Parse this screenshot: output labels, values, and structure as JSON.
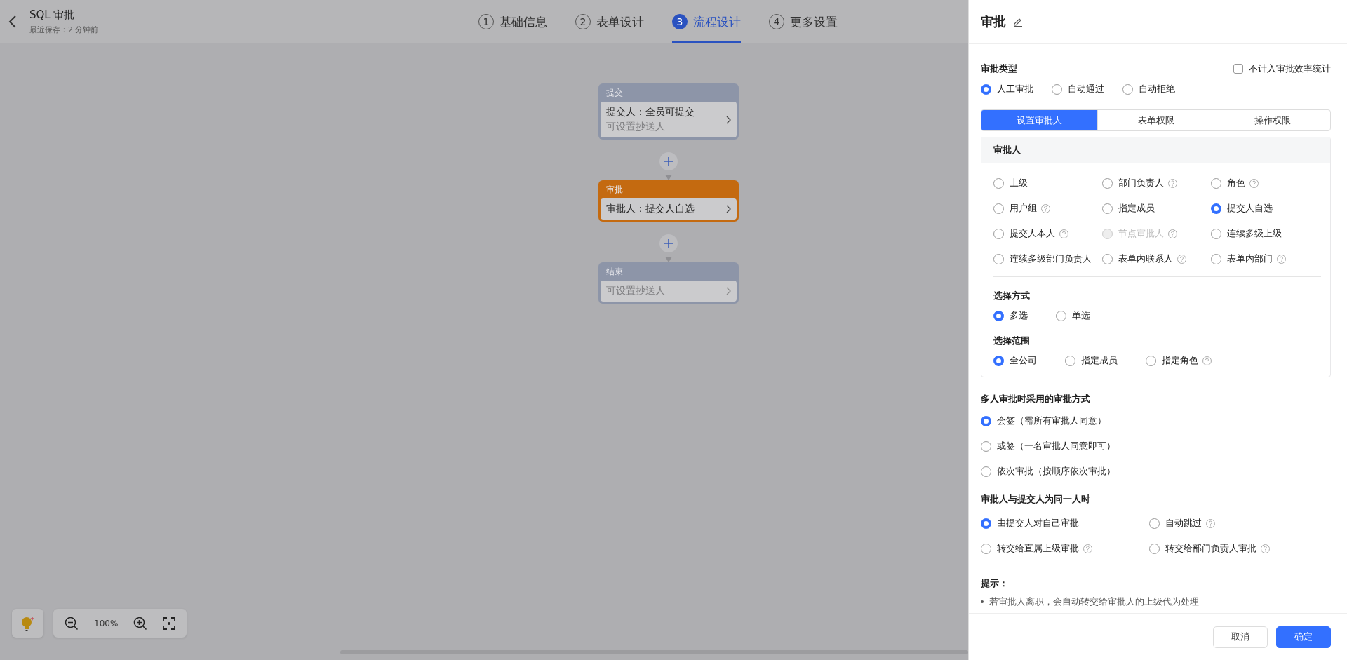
{
  "header": {
    "title": "SQL 审批",
    "subtitle": "最近保存：2 分钟前"
  },
  "steps": [
    {
      "number": "1",
      "label": "基础信息",
      "selected": false
    },
    {
      "number": "2",
      "label": "表单设计",
      "selected": false
    },
    {
      "number": "3",
      "label": "流程设计",
      "selected": true
    },
    {
      "number": "4",
      "label": "更多设置",
      "selected": false
    }
  ],
  "flow": {
    "nodes": [
      {
        "kind": "start",
        "title": "提交",
        "lines": [
          {
            "text": "提交人：全员可提交",
            "muted": false
          },
          {
            "text": "可设置抄送人",
            "muted": true
          }
        ]
      },
      {
        "kind": "approval",
        "title": "审批",
        "lines": [
          {
            "text": "审批人：提交人自选",
            "muted": false
          }
        ]
      },
      {
        "kind": "end",
        "title": "结束",
        "lines": [
          {
            "text": "可设置抄送人",
            "muted": true
          }
        ]
      }
    ]
  },
  "zoom_controls": {
    "zoom": "100%"
  },
  "panel": {
    "title": "审批",
    "type_label": "审批类型",
    "exclude_stats": {
      "label": "不计入审批效率统计",
      "checked": false
    },
    "approval_types": [
      {
        "label": "人工审批",
        "selected": true
      },
      {
        "label": "自动通过",
        "selected": false
      },
      {
        "label": "自动拒绝",
        "selected": false
      }
    ],
    "tabs": [
      {
        "label": "设置审批人",
        "selected": true
      },
      {
        "label": "表单权限",
        "selected": false
      },
      {
        "label": "操作权限",
        "selected": false
      }
    ],
    "approver": {
      "title": "审批人",
      "options": [
        {
          "label": "上级",
          "selected": false,
          "disabled": false,
          "kind": "plain"
        },
        {
          "label": "部门负责人",
          "selected": false,
          "disabled": false,
          "kind": "help"
        },
        {
          "label": "角色",
          "selected": false,
          "disabled": false,
          "kind": "help"
        },
        {
          "label": "用户组",
          "selected": false,
          "disabled": false,
          "kind": "help"
        },
        {
          "label": "指定成员",
          "selected": false,
          "disabled": false,
          "kind": "plain"
        },
        {
          "label": "提交人自选",
          "selected": true,
          "disabled": false,
          "kind": "plain"
        },
        {
          "label": "提交人本人",
          "selected": false,
          "disabled": false,
          "kind": "help"
        },
        {
          "label": "节点审批人",
          "selected": false,
          "disabled": true,
          "kind": "help"
        },
        {
          "label": "连续多级上级",
          "selected": false,
          "disabled": false,
          "kind": "plain"
        },
        {
          "label": "连续多级部门负责人",
          "selected": false,
          "disabled": false,
          "kind": "plain"
        },
        {
          "label": "表单内联系人",
          "selected": false,
          "disabled": false,
          "kind": "help"
        },
        {
          "label": "表单内部门",
          "selected": false,
          "disabled": false,
          "kind": "help"
        }
      ]
    },
    "select_mode": {
      "title": "选择方式",
      "options": [
        {
          "label": "多选",
          "selected": true
        },
        {
          "label": "单选",
          "selected": false
        }
      ]
    },
    "select_scope": {
      "title": "选择范围",
      "options": [
        {
          "label": "全公司",
          "selected": true,
          "kind": "plain"
        },
        {
          "label": "指定成员",
          "selected": false,
          "kind": "plain"
        },
        {
          "label": "指定角色",
          "selected": false,
          "kind": "help"
        }
      ]
    },
    "multi_approval": {
      "title": "多人审批时采用的审批方式",
      "options": [
        {
          "label": "会签（需所有审批人同意）",
          "selected": true
        },
        {
          "label": "或签（一名审批人同意即可）",
          "selected": false
        },
        {
          "label": "依次审批（按顺序依次审批）",
          "selected": false
        }
      ]
    },
    "same_person": {
      "title": "审批人与提交人为同一人时",
      "options": [
        {
          "label": "由提交人对自己审批",
          "selected": true,
          "kind": "plain"
        },
        {
          "label": "自动跳过",
          "selected": false,
          "kind": "help"
        },
        {
          "label": "转交给直属上级审批",
          "selected": false,
          "kind": "help"
        },
        {
          "label": "转交给部门负责人审批",
          "selected": false,
          "kind": "help"
        }
      ]
    },
    "hint": {
      "title": "提示：",
      "items": [
        "若审批人离职，会自动转交给审批人的上级代为处理"
      ]
    },
    "buttons": [
      {
        "label": "取消",
        "kind": "secondary"
      },
      {
        "label": "确定",
        "kind": "primary"
      }
    ]
  }
}
